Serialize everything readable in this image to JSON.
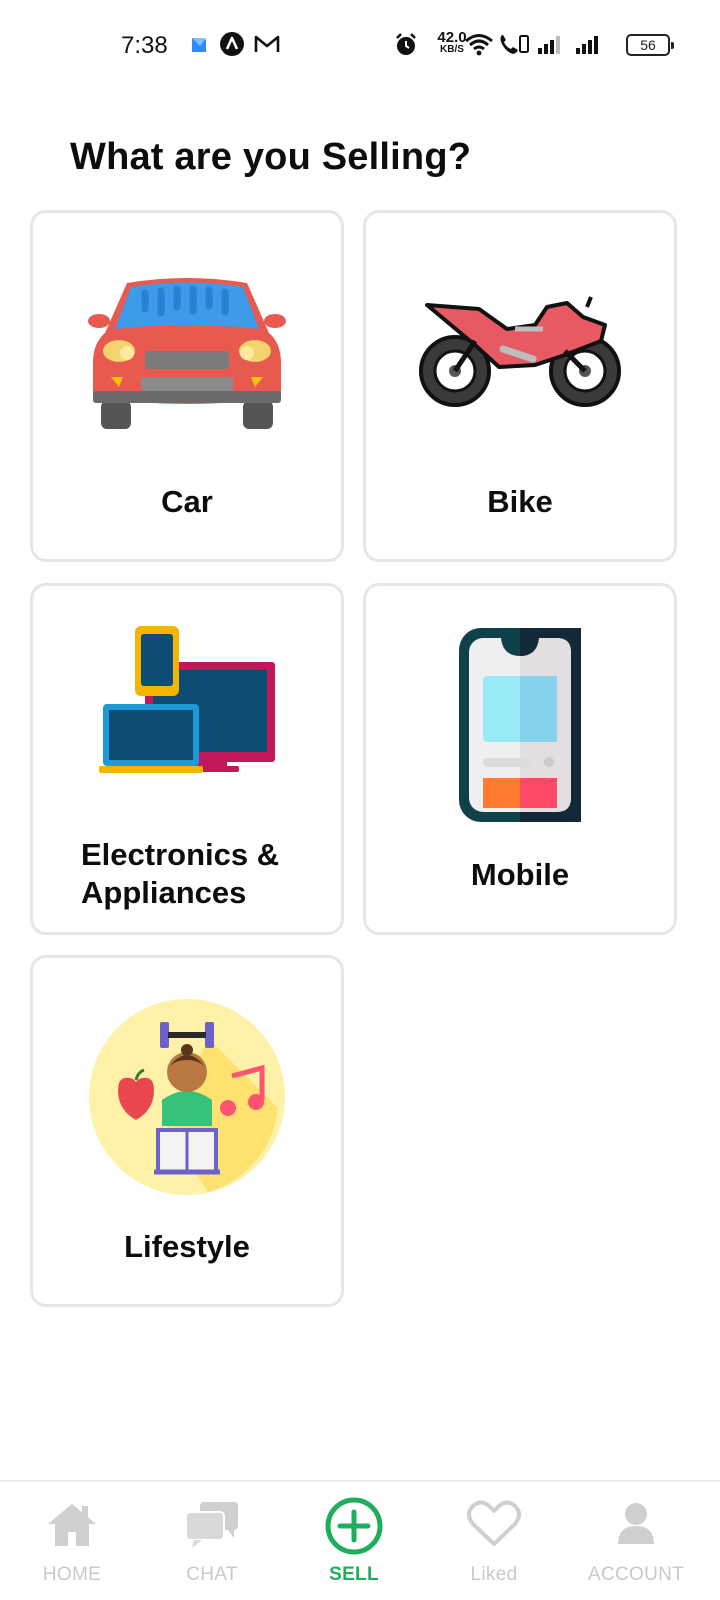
{
  "status_bar": {
    "time": "7:38",
    "net_speed_value": "42.0",
    "net_speed_unit": "KB/S",
    "battery": "56",
    "icons": [
      "app-notification-icon",
      "arc-icon",
      "gmail-icon",
      "alarm-icon",
      "wifi-icon",
      "volte-call-icon",
      "signal-icon",
      "signal-icon",
      "battery-icon"
    ]
  },
  "page": {
    "title": "What are you Selling?"
  },
  "categories": [
    {
      "label": "Car",
      "icon": "car-icon"
    },
    {
      "label": "Bike",
      "icon": "motorbike-icon"
    },
    {
      "label": "Electronics &",
      "label2": "Appliances",
      "icon": "electronics-icon"
    },
    {
      "label": "Mobile",
      "icon": "mobile-phone-icon"
    },
    {
      "label": "Lifestyle",
      "icon": "lifestyle-icon"
    }
  ],
  "bottom_nav": {
    "items": [
      {
        "label": "HOME",
        "icon": "home-icon"
      },
      {
        "label": "CHAT",
        "icon": "chat-icon"
      },
      {
        "label": "SELL",
        "icon": "plus-circle-icon",
        "active": true
      },
      {
        "label": "Liked",
        "icon": "heart-icon"
      },
      {
        "label": "ACCOUNT",
        "icon": "user-icon"
      }
    ],
    "active_color": "#1fae5c",
    "inactive_color": "#c9c9c9"
  }
}
